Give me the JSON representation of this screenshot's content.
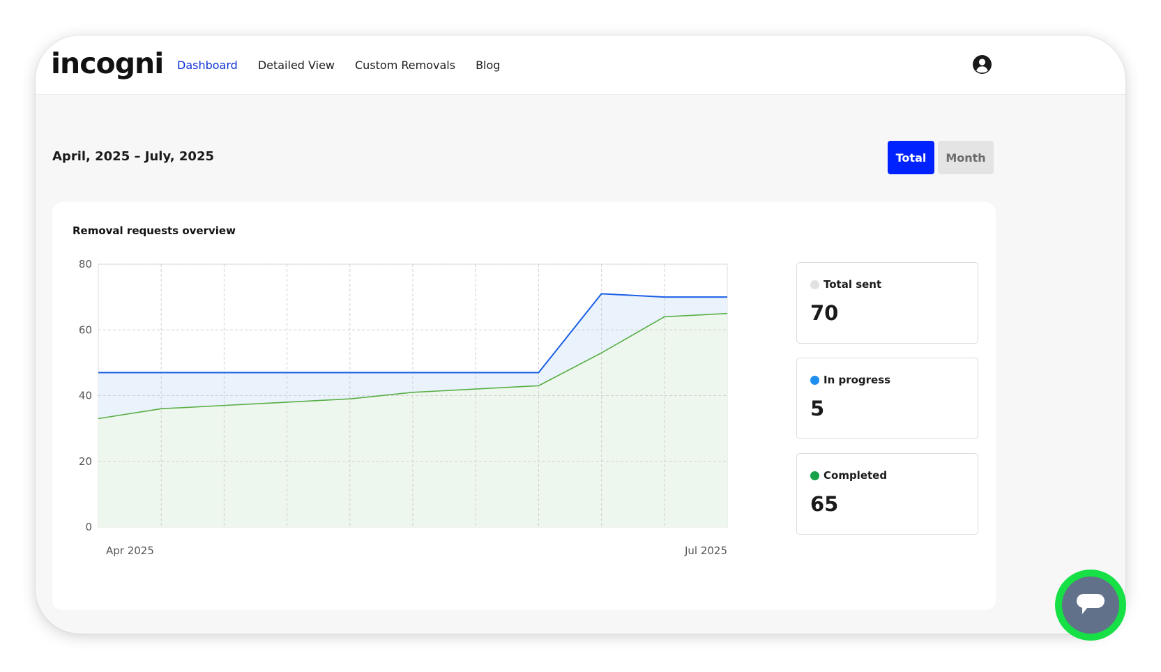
{
  "brand": {
    "logo_text": "incogni"
  },
  "nav": {
    "items": [
      {
        "label": "Dashboard",
        "active": true
      },
      {
        "label": "Detailed View",
        "active": false
      },
      {
        "label": "Custom Removals",
        "active": false
      },
      {
        "label": "Blog",
        "active": false
      }
    ]
  },
  "header": {
    "date_range": "April, 2025 – July, 2025"
  },
  "toggle": {
    "total_label": "Total",
    "month_label": "Month",
    "selected": "Total"
  },
  "card": {
    "title": "Removal requests overview"
  },
  "stats": [
    {
      "label": "Total sent",
      "value": "70",
      "dot_color": "#e2e2e2"
    },
    {
      "label": "In progress",
      "value": "5",
      "dot_color": "#1f8ef1"
    },
    {
      "label": "Completed",
      "value": "65",
      "dot_color": "#17a24a"
    }
  ],
  "chart_data": {
    "type": "area",
    "title": "Removal requests overview",
    "xlabel": "",
    "ylabel": "",
    "ylim": [
      0,
      80
    ],
    "yticks": [
      0,
      20,
      40,
      60,
      80
    ],
    "x_tick_labels": [
      "Apr 2025",
      "Jul 2025"
    ],
    "x_points": 11,
    "grid": true,
    "series": [
      {
        "name": "Total sent",
        "color": "#1a5fe6",
        "fill": "#eaf2fb",
        "values": [
          47,
          47,
          47,
          47,
          47,
          47,
          47,
          47,
          71,
          70,
          70
        ]
      },
      {
        "name": "Completed",
        "color": "#58ae45",
        "fill": "#eef7ee",
        "values": [
          33,
          36,
          37,
          38,
          39,
          41,
          42,
          43,
          53,
          64,
          65
        ]
      }
    ]
  }
}
